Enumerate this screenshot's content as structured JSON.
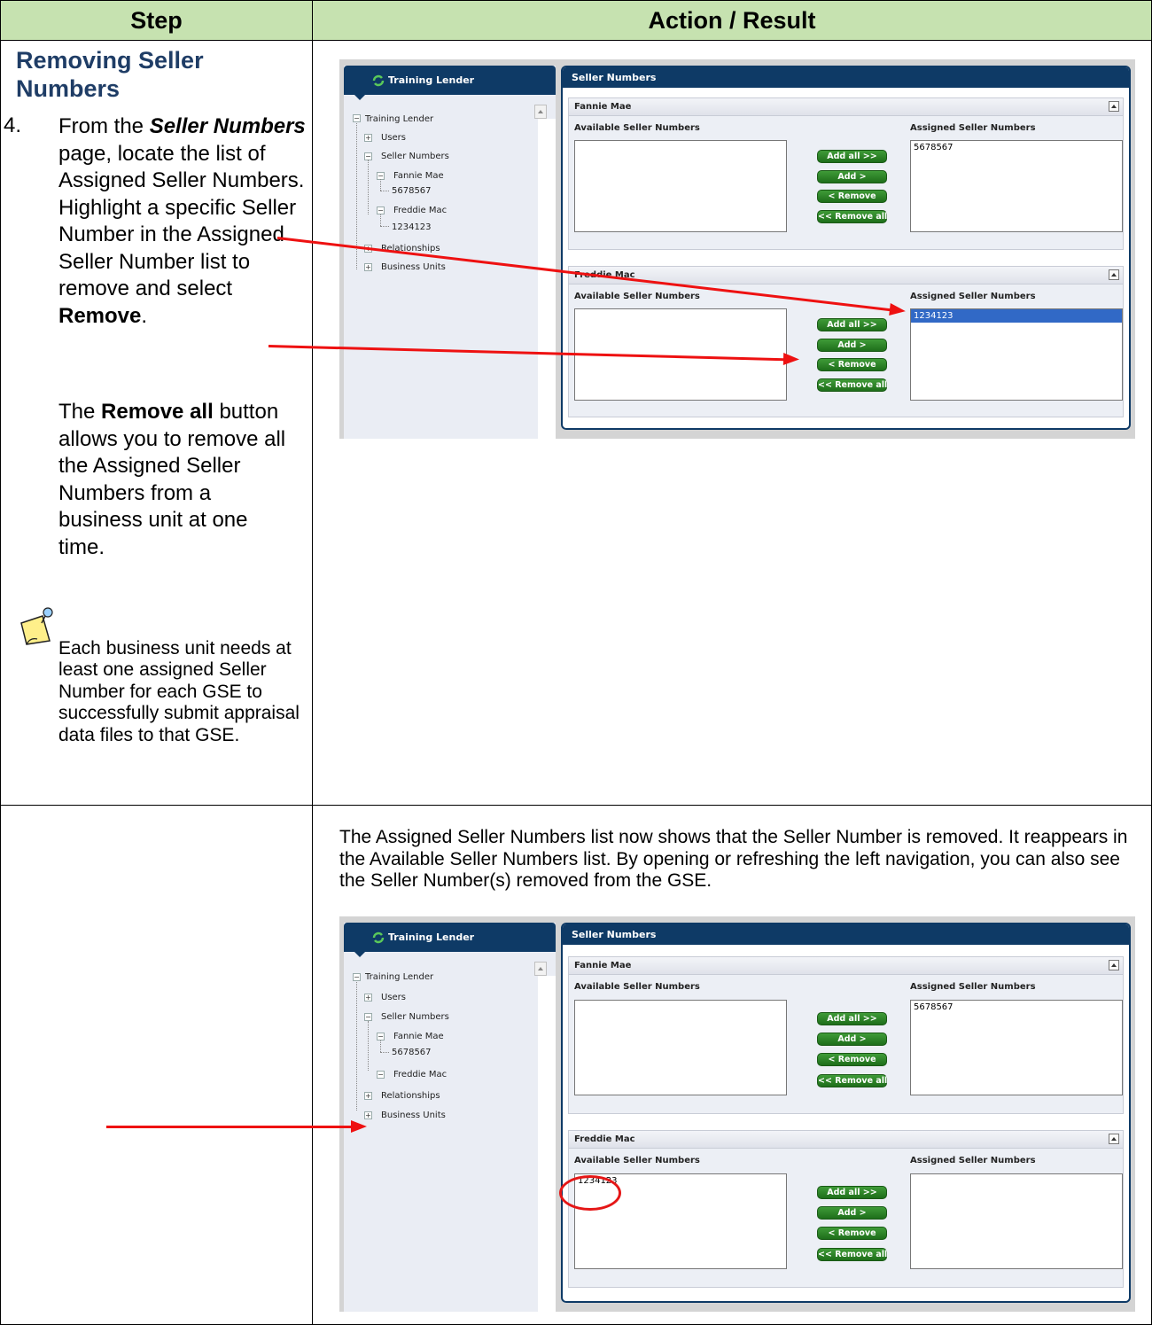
{
  "header": {
    "step": "Step",
    "action": "Action / Result"
  },
  "step": {
    "title": "Removing Seller Numbers",
    "number": "4.",
    "intro": "From the",
    "page_name": "Seller Numbers",
    "body1": "page, locate the list of Assigned Seller Numbers. Highlight a specific Seller Number in the Assigned Seller Number list to remove and select",
    "remove": "Remove",
    "period": ".",
    "note_pre": "The",
    "remove_all": "Remove all",
    "note_post": "button allows you to remove all the Assigned Seller Numbers from a business unit at one time.",
    "note_icon": "note-pushpin-icon",
    "tip": "Each business unit needs at least one assigned Seller Number for each GSE to successfully submit appraisal data files to that GSE."
  },
  "result_text": "The Assigned Seller Numbers list now shows that the Seller Number is removed.  It reappears in the Available Seller Numbers list.  By opening or refreshing the left navigation, you can also see the Seller Number(s) removed from the GSE.",
  "app": {
    "lender": "Training Lender",
    "page_title": "Seller Numbers",
    "available_label": "Available Seller Numbers",
    "assigned_label": "Assigned Seller Numbers",
    "buttons": {
      "add_all": "Add all  >>",
      "add": "Add  >",
      "remove": "<  Remove",
      "remove_all": "<<  Remove all"
    },
    "gse1": "Fannie Mae",
    "gse2": "Freddie Mac",
    "tree_root": "Training Lender",
    "tree_users": "Users",
    "tree_seller_numbers": "Seller Numbers",
    "tree_relationships": "Relationships",
    "tree_business_units": "Business Units",
    "fannie_number": "5678567",
    "freddie_number": "1234123"
  },
  "colors": {
    "header_bg": "#c6e2b0",
    "title": "#1f3d66",
    "nav": "#0e3a66",
    "button": "#2a8a24",
    "arrow": "#ee1111",
    "selection": "#3169c6"
  }
}
